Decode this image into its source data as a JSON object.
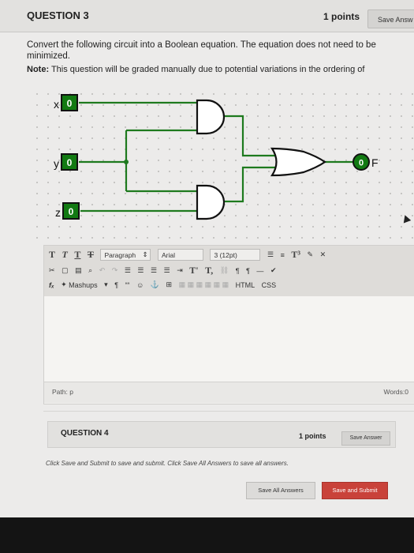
{
  "question3": {
    "title": "QUESTION 3",
    "points": "1 points",
    "save_label": "Save Answ",
    "prompt": "Convert the following circuit into a Boolean equation. The equation does not need to be minimized.",
    "note_label": "Note:",
    "note_text": " This question will be graded manually due to potential variations in the ordering of"
  },
  "circuit": {
    "inputs": [
      {
        "label": "x",
        "value": "0"
      },
      {
        "label": "y",
        "value": "0"
      },
      {
        "label": "z",
        "value": "0"
      }
    ],
    "output": {
      "label": "F",
      "value": "0"
    },
    "colors": {
      "wire": "#1e7a1e",
      "gate_stroke": "#111111",
      "gate_fill": "#ffffff",
      "input_fill": "#127a12"
    }
  },
  "editor": {
    "toolbar_row1": {
      "text_buttons": [
        "T",
        "T",
        "T",
        "T"
      ],
      "paragraph": "Paragraph",
      "font": "Arial",
      "size": "3 (12pt)",
      "t_icon": "T³"
    },
    "toolbar_row2": {
      "super": "T'",
      "sub": "T,"
    },
    "toolbar_row3": {
      "fx": "fₓ",
      "mashups": "Mashups",
      "pilcrow": "¶",
      "quote": "““",
      "html": "HTML",
      "css": "CSS"
    },
    "path": "Path: p",
    "words": "Words:0"
  },
  "question4": {
    "title": "QUESTION 4",
    "points": "1 points",
    "save_label": "Save Answer"
  },
  "footer": {
    "instructions": "Click Save and Submit to save and submit. Click Save All Answers to save all answers.",
    "save_all": "Save All Answers",
    "save_submit": "Save and Submit",
    "submit_color": "#c9423a"
  }
}
